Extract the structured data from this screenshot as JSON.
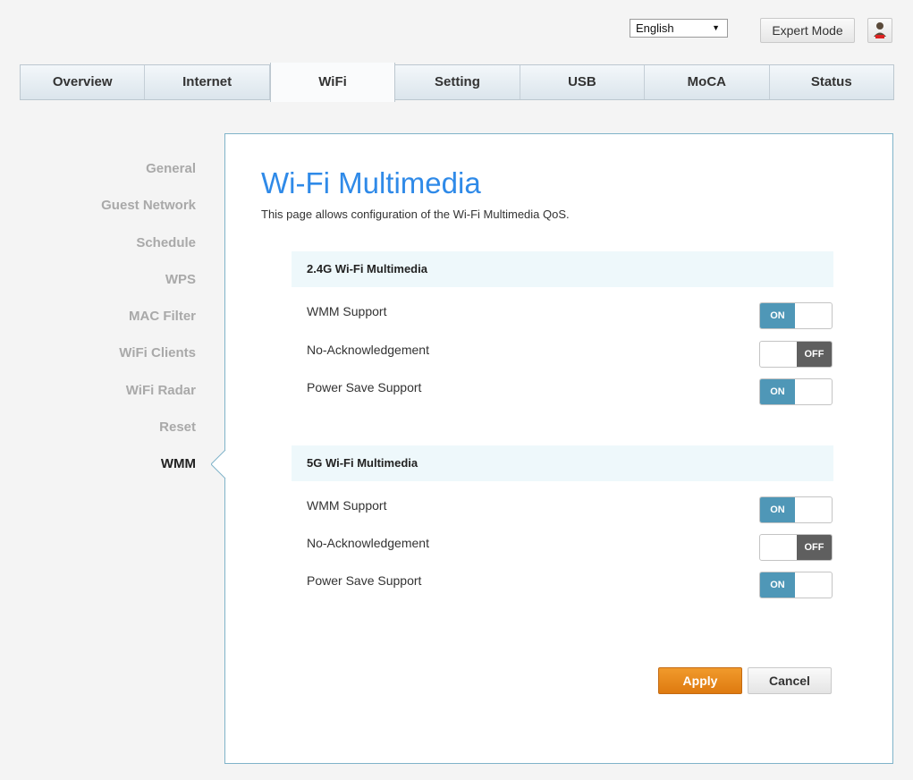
{
  "header": {
    "language": "English",
    "expert_mode_label": "Expert Mode",
    "user_icon": "user-icon"
  },
  "nav": {
    "tabs": [
      {
        "label": "Overview"
      },
      {
        "label": "Internet"
      },
      {
        "label": "WiFi",
        "active": true
      },
      {
        "label": "Setting"
      },
      {
        "label": "USB"
      },
      {
        "label": "MoCA"
      },
      {
        "label": "Status"
      }
    ]
  },
  "sidebar": {
    "items": [
      {
        "label": "General"
      },
      {
        "label": "Guest Network"
      },
      {
        "label": "Schedule"
      },
      {
        "label": "WPS"
      },
      {
        "label": "MAC Filter"
      },
      {
        "label": "WiFi Clients"
      },
      {
        "label": "WiFi Radar"
      },
      {
        "label": "Reset"
      },
      {
        "label": "WMM",
        "active": true
      }
    ]
  },
  "main": {
    "title": "Wi-Fi Multimedia",
    "description": "This page allows configuration of the Wi-Fi Multimedia QoS.",
    "sections": [
      {
        "heading": "2.4G Wi-Fi Multimedia",
        "rows": [
          {
            "label": "WMM Support",
            "state": "ON"
          },
          {
            "label": "No-Acknowledgement",
            "state": "OFF"
          },
          {
            "label": "Power Save Support",
            "state": "ON"
          }
        ]
      },
      {
        "heading": "5G Wi-Fi Multimedia",
        "rows": [
          {
            "label": "WMM Support",
            "state": "ON"
          },
          {
            "label": "No-Acknowledgement",
            "state": "OFF"
          },
          {
            "label": "Power Save Support",
            "state": "ON"
          }
        ]
      }
    ],
    "apply_label": "Apply",
    "cancel_label": "Cancel"
  },
  "colors": {
    "accent_title": "#2f8ae8",
    "toggle_on": "#4f97b7",
    "toggle_off": "#5f5f5f",
    "apply": "#e8871c",
    "panel_border": "#7fb3c9"
  }
}
